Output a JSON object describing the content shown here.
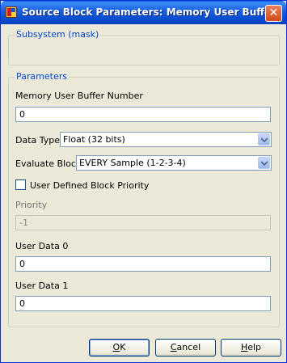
{
  "window": {
    "title": "Source Block Parameters: Memory User Buffer",
    "close_glyph": "✕"
  },
  "subsystem_group": {
    "legend": "Subsystem (mask)"
  },
  "parameters_group": {
    "legend": "Parameters"
  },
  "fields": {
    "memory_user_buffer_number": {
      "label": "Memory User Buffer Number",
      "value": "0"
    },
    "data_type": {
      "label": "Data Type",
      "selected": "Float (32 bits)"
    },
    "evaluate_block": {
      "label": "Evaluate Block",
      "selected": "EVERY Sample (1-2-3-4)"
    },
    "user_defined_priority": {
      "label": "User Defined Block Priority",
      "checked": false
    },
    "priority": {
      "label": "Priority",
      "value": "-1",
      "disabled": true
    },
    "user_data_0": {
      "label": "User Data 0",
      "value": "0"
    },
    "user_data_1": {
      "label": "User Data 1",
      "value": "0"
    }
  },
  "buttons": {
    "ok": {
      "label": "OK",
      "mnemonic": "O",
      "rest": "K"
    },
    "cancel": {
      "label": "Cancel",
      "mnemonic": "C",
      "rest": "ancel"
    },
    "help": {
      "label": "Help",
      "mnemonic": "H",
      "rest": "elp"
    }
  },
  "colors": {
    "titlebar": "#0a51d6",
    "group_legend": "#0046d5",
    "dialog_bg": "#ece9d8"
  },
  "icons": [
    "app-icon",
    "close-icon",
    "dropdown-arrow-icon"
  ]
}
